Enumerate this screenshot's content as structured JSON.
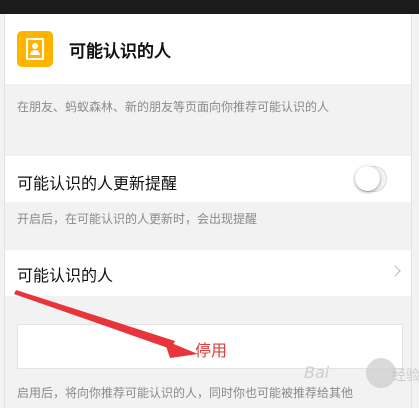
{
  "header": {
    "title": "可能认识的人",
    "icon": "contact-card-icon"
  },
  "description_main": "在朋友、蚂蚁森林、新的朋友等页面向你推荐可能认识的人",
  "update_reminder": {
    "label": "可能认识的人更新提醒",
    "enabled": false,
    "description": "开启后，在可能认识的人更新时，会出现提醒"
  },
  "people_row": {
    "label": "可能认识的人",
    "icon": "chevron-right-icon"
  },
  "disable_button": {
    "label": "停用",
    "color": "#e03b3b"
  },
  "footer_description": "启用后，将向你推荐可能认识的人，同时你也可能被推荐给其他",
  "watermark": {
    "text": "Bai",
    "tail": "经验"
  },
  "colors": {
    "accent": "#ffb400",
    "arrow": "#e8353b",
    "background": "#f2f2f2"
  }
}
